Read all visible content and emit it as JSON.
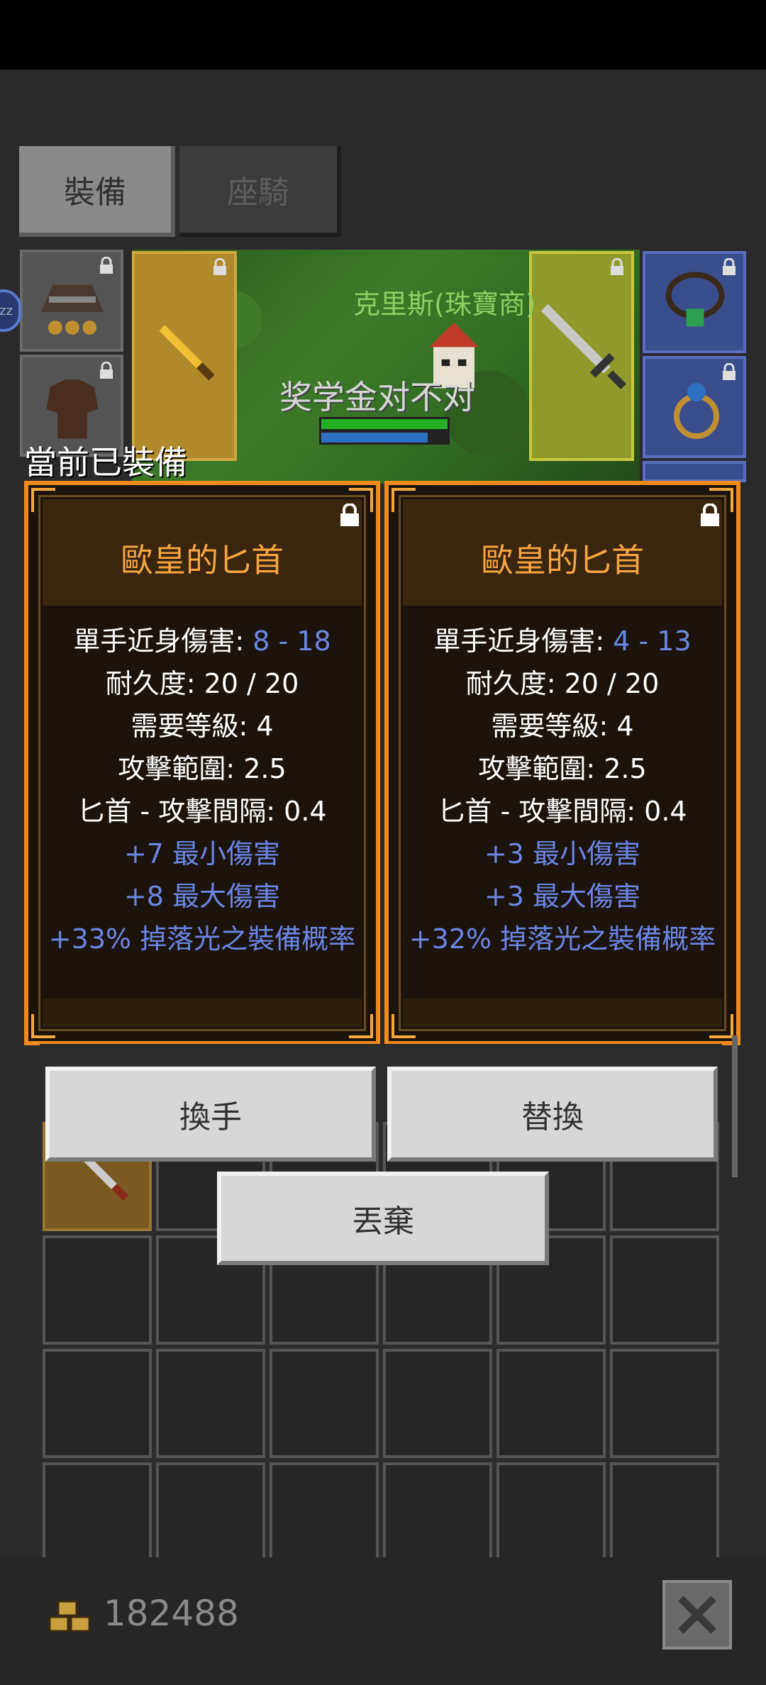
{
  "tabs": [
    {
      "label": "裝備",
      "active": true
    },
    {
      "label": "座騎",
      "active": false
    }
  ],
  "scene": {
    "npc_name": "克里斯(珠寶商)",
    "player_name": "奖学金对不对",
    "hp_fraction": 1.0,
    "mp_fraction": 0.85
  },
  "equipped_label": "當前已裝備",
  "cards": [
    {
      "title": "歐皇的匕首",
      "damage_label": "單手近身傷害: ",
      "damage_value": "8 - 18",
      "durability": "耐久度: 20 / 20",
      "level": "需要等級: 4",
      "range": "攻擊範圍: 2.5",
      "speed": "匕首 - 攻擊間隔: 0.4",
      "bonus_min": "+7 最小傷害",
      "bonus_max": "+8 最大傷害",
      "bonus_drop": "+33% 掉落光之裝備概率"
    },
    {
      "title": "歐皇的匕首",
      "damage_label": "單手近身傷害: ",
      "damage_value": "4 - 13",
      "durability": "耐久度: 20 / 20",
      "level": "需要等級: 4",
      "range": "攻擊範圍: 2.5",
      "speed": "匕首 - 攻擊間隔: 0.4",
      "bonus_min": "+3 最小傷害",
      "bonus_max": "+3 最大傷害",
      "bonus_drop": "+32% 掉落光之裝備概率"
    }
  ],
  "buttons": {
    "swap_hand": "換手",
    "replace": "替換",
    "discard": "丟棄"
  },
  "gold": "182488",
  "colors": {
    "card_border": "#f08a1c",
    "title": "#f7a440",
    "bonus_blue": "#6a86e6"
  }
}
